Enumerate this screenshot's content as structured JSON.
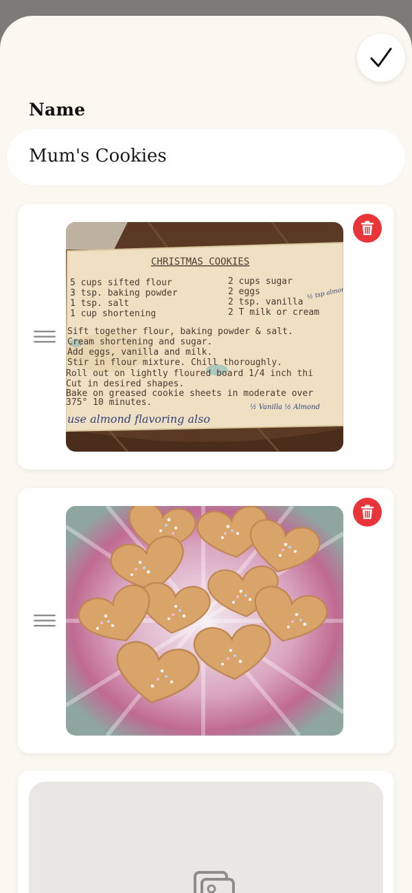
{
  "header": {
    "confirm_icon": "checkmark-icon"
  },
  "form": {
    "name_label": "Name",
    "name_value": "Mum's Cookies"
  },
  "photos": [
    {
      "kind": "recipe-card-photo",
      "card_title": "CHRISTMAS COOKIES",
      "ingredients_left": [
        "5 cups sifted flour",
        "3 tsp. baking powder",
        "1 tsp. salt",
        "1 cup shortening"
      ],
      "ingredients_right": [
        "2 cups sugar",
        "2 eggs",
        "2 tsp. vanilla",
        "2 T milk or cream"
      ],
      "instructions": [
        "Sift together flour, baking powder & salt.",
        "Cream shortening and sugar.",
        "Add eggs, vanilla and milk.",
        "Stir in flour mixture.   Chill thoroughly.",
        "Roll out on lightly floured board 1/4 inch thi",
        "Cut in desired shapes.",
        "Bake on greased cookie sheets in moderate over",
        "375° 10 minutes."
      ],
      "handwritten_note": "use almond flavoring also",
      "handwritten_side": "½ tsp almond",
      "handwritten_margin": "½ Vanilla  ½ Almond",
      "delete_icon": "trash-icon",
      "drag_icon": "drag-handle-icon"
    },
    {
      "kind": "cookies-photo",
      "delete_icon": "trash-icon",
      "drag_icon": "drag-handle-icon"
    }
  ],
  "add_photo": {
    "icon": "photos-icon"
  },
  "colors": {
    "background": "#faf8f0",
    "card": "#ffffff",
    "delete": "#e8353a",
    "placeholder": "#e8e7e3"
  }
}
